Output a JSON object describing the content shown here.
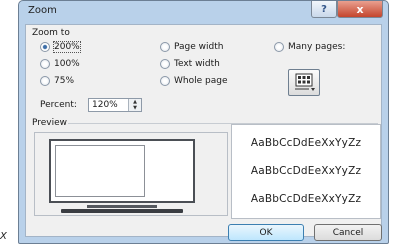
{
  "stray_text": "X",
  "window": {
    "title": "Zoom",
    "help_icon": "?",
    "close_icon": "x"
  },
  "zoom_to": {
    "label": "Zoom to",
    "options": [
      {
        "label": "200%",
        "checked": true
      },
      {
        "label": "100%",
        "checked": false
      },
      {
        "label": "75%",
        "checked": false
      },
      {
        "label": "Page width",
        "checked": false
      },
      {
        "label": "Text width",
        "checked": false
      },
      {
        "label": "Whole page",
        "checked": false
      },
      {
        "label": "Many pages:",
        "checked": false
      }
    ],
    "many_pages_button_icon": "pages-grid-icon"
  },
  "percent": {
    "label": "Percent:",
    "value": "120%"
  },
  "preview": {
    "label": "Preview",
    "samples": [
      "AaBbCcDdEeXxYyZz",
      "AaBbCcDdEeXxYyZz",
      "AaBbCcDdEeXxYyZz"
    ]
  },
  "buttons": {
    "ok": "OK",
    "cancel": "Cancel"
  }
}
